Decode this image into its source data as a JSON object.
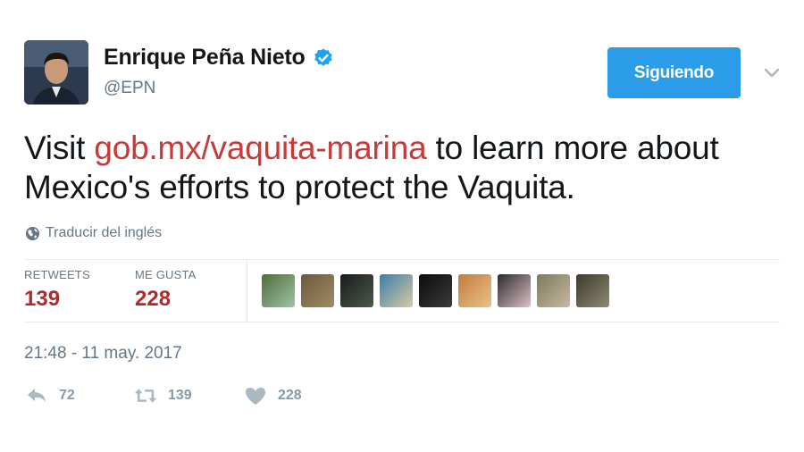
{
  "author": {
    "display_name": "Enrique Peña Nieto",
    "handle": "@EPN",
    "verified": true
  },
  "follow_button": {
    "label": "Siguiendo",
    "color": "#2a9ce8"
  },
  "tweet": {
    "text_before": "Visit ",
    "link_text": "gob.mx/vaquita-marina",
    "text_after": " to learn more about Mexico's efforts to protect the Vaquita.",
    "link_color": "#c63a3a"
  },
  "translate_label": "Traducir del inglés",
  "stats": {
    "retweets_label": "RETWEETS",
    "retweets_value": "139",
    "likes_label": "ME GUSTA",
    "likes_value": "228"
  },
  "likers": [
    {
      "color_a": "#4f6d3a",
      "color_b": "#9ec3a6"
    },
    {
      "color_a": "#6b5a3d",
      "color_b": "#a08a66"
    },
    {
      "color_a": "#1b1b1b",
      "color_b": "#4a5a4a"
    },
    {
      "color_a": "#3a7fa8",
      "color_b": "#d9c9a3"
    },
    {
      "color_a": "#0c0c0c",
      "color_b": "#3a3a3a"
    },
    {
      "color_a": "#c47a3b",
      "color_b": "#e8c38a"
    },
    {
      "color_a": "#2a2a2a",
      "color_b": "#e0c0c8"
    },
    {
      "color_a": "#7a7c5a",
      "color_b": "#c9b7a0"
    },
    {
      "color_a": "#3e3a2c",
      "color_b": "#8c8a73"
    }
  ],
  "timestamp": "21:48 - 11 may. 2017",
  "actions": {
    "reply_count": "72",
    "retweet_count": "139",
    "like_count": "228"
  }
}
